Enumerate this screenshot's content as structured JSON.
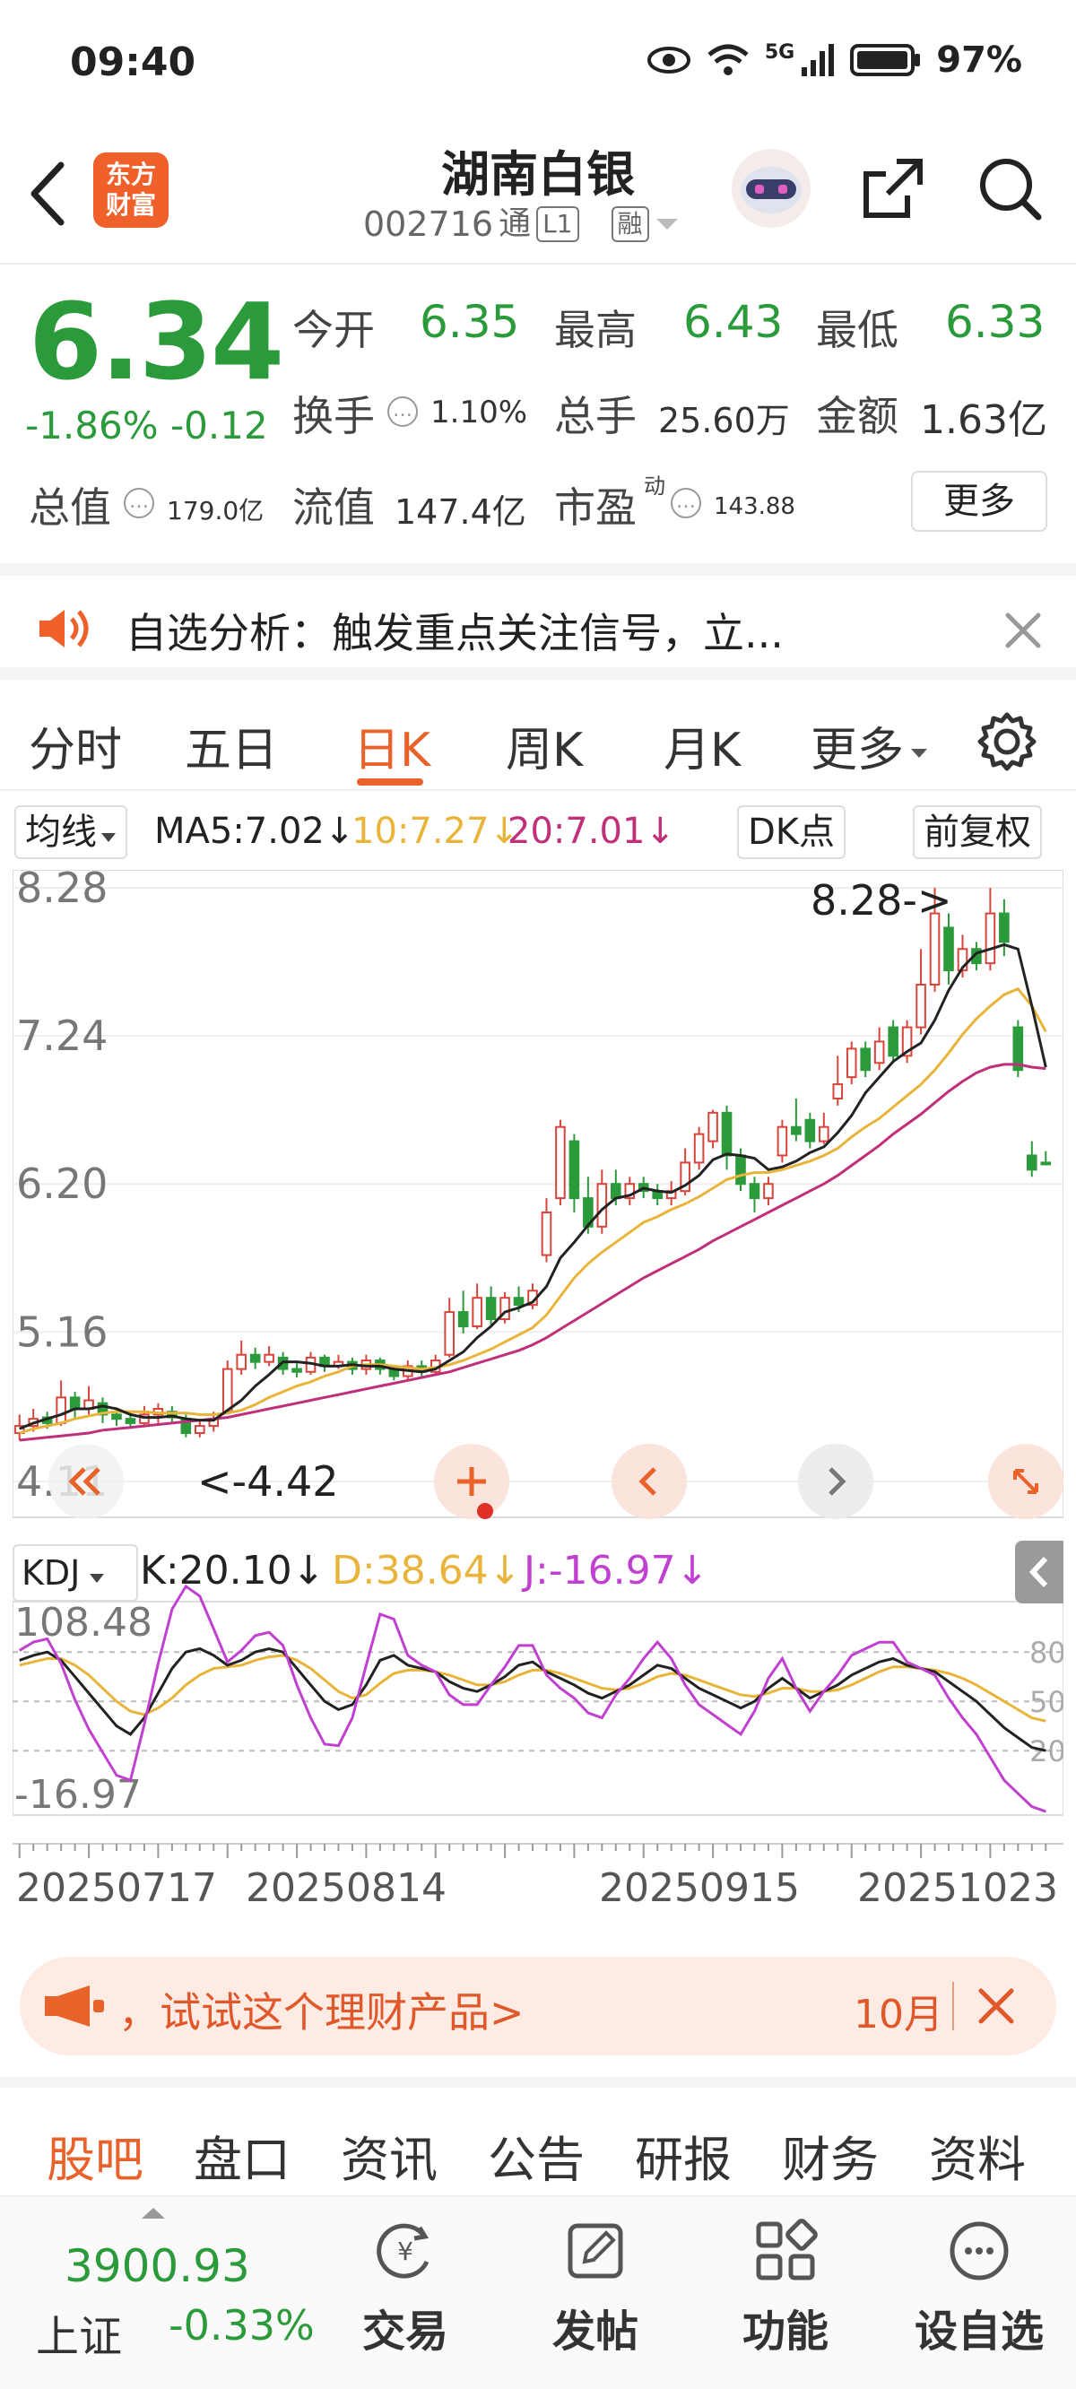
{
  "status_bar": {
    "time": "09:40",
    "battery": "97%",
    "network": "5G"
  },
  "header": {
    "logo_text_1": "东方",
    "logo_text_2": "财富",
    "stock_name": "湖南白银",
    "stock_code": "002716",
    "tags": [
      "通",
      "L1",
      "融"
    ]
  },
  "quote": {
    "price": "6.34",
    "change_pct": "-1.86%",
    "change_abs": "-0.12",
    "open_label": "今开",
    "open": "6.35",
    "high_label": "最高",
    "high": "6.43",
    "low_label": "最低",
    "low": "6.33",
    "turnover_label": "换手",
    "turnover": "1.10%",
    "volume_label": "总手",
    "volume": "25.60万",
    "amount_label": "金额",
    "amount": "1.63亿",
    "mktcap_label": "总值",
    "mktcap": "179.0亿",
    "float_label": "流值",
    "float": "147.4亿",
    "pe_label": "市盈",
    "pe_sup": "动",
    "pe": "143.88",
    "more_label": "更多"
  },
  "notice": {
    "text": "自选分析：触发重点关注信号，立..."
  },
  "tabs": [
    "分时",
    "五日",
    "日K",
    "周K",
    "月K",
    "更多"
  ],
  "active_tab": "日K",
  "ma_bar": {
    "selector": "均线",
    "ma5": "MA5:7.02↓",
    "ma10": "10:7.27↓",
    "ma20": "20:7.01↓",
    "dk": "DK点",
    "adjust": "前复权"
  },
  "chart_data": {
    "type": "candlestick",
    "y_ticks": [
      "8.28",
      "7.24",
      "6.20",
      "5.16",
      "4.11"
    ],
    "ylim": [
      4.11,
      8.28
    ],
    "max_label": "8.28->",
    "min_label": "<-4.42",
    "x_labels": [
      "20250717",
      "20250814",
      "20250915",
      "20251023"
    ],
    "candles": [
      {
        "o": 4.45,
        "c": 4.5,
        "h": 4.58,
        "l": 4.4
      },
      {
        "o": 4.5,
        "c": 4.55,
        "h": 4.62,
        "l": 4.46
      },
      {
        "o": 4.56,
        "c": 4.52,
        "h": 4.6,
        "l": 4.48
      },
      {
        "o": 4.52,
        "c": 4.7,
        "h": 4.82,
        "l": 4.5
      },
      {
        "o": 4.7,
        "c": 4.62,
        "h": 4.74,
        "l": 4.55
      },
      {
        "o": 4.62,
        "c": 4.68,
        "h": 4.78,
        "l": 4.58
      },
      {
        "o": 4.66,
        "c": 4.58,
        "h": 4.7,
        "l": 4.52
      },
      {
        "o": 4.58,
        "c": 4.55,
        "h": 4.63,
        "l": 4.5
      },
      {
        "o": 4.55,
        "c": 4.52,
        "h": 4.6,
        "l": 4.48
      },
      {
        "o": 4.52,
        "c": 4.58,
        "h": 4.64,
        "l": 4.49
      },
      {
        "o": 4.58,
        "c": 4.62,
        "h": 4.66,
        "l": 4.52
      },
      {
        "o": 4.6,
        "c": 4.56,
        "h": 4.64,
        "l": 4.52
      },
      {
        "o": 4.55,
        "c": 4.45,
        "h": 4.58,
        "l": 4.42
      },
      {
        "o": 4.45,
        "c": 4.5,
        "h": 4.55,
        "l": 4.42
      },
      {
        "o": 4.5,
        "c": 4.55,
        "h": 4.6,
        "l": 4.46
      },
      {
        "o": 4.6,
        "c": 4.9,
        "h": 4.96,
        "l": 4.58
      },
      {
        "o": 4.9,
        "c": 5.0,
        "h": 5.1,
        "l": 4.86
      },
      {
        "o": 5.0,
        "c": 4.95,
        "h": 5.05,
        "l": 4.9
      },
      {
        "o": 4.95,
        "c": 5.0,
        "h": 5.06,
        "l": 4.92
      },
      {
        "o": 4.98,
        "c": 4.9,
        "h": 5.02,
        "l": 4.86
      },
      {
        "o": 4.9,
        "c": 4.88,
        "h": 4.94,
        "l": 4.84
      },
      {
        "o": 4.88,
        "c": 4.98,
        "h": 5.02,
        "l": 4.86
      },
      {
        "o": 4.98,
        "c": 4.92,
        "h": 5.0,
        "l": 4.88
      },
      {
        "o": 4.92,
        "c": 4.95,
        "h": 5.0,
        "l": 4.9
      },
      {
        "o": 4.95,
        "c": 4.9,
        "h": 4.98,
        "l": 4.86
      },
      {
        "o": 4.9,
        "c": 4.96,
        "h": 5.0,
        "l": 4.86
      },
      {
        "o": 4.96,
        "c": 4.9,
        "h": 4.98,
        "l": 4.86
      },
      {
        "o": 4.9,
        "c": 4.85,
        "h": 4.92,
        "l": 4.82
      },
      {
        "o": 4.85,
        "c": 4.92,
        "h": 4.96,
        "l": 4.82
      },
      {
        "o": 4.92,
        "c": 4.88,
        "h": 4.96,
        "l": 4.84
      },
      {
        "o": 4.88,
        "c": 4.96,
        "h": 5.0,
        "l": 4.85
      },
      {
        "o": 5.0,
        "c": 5.3,
        "h": 5.4,
        "l": 4.98
      },
      {
        "o": 5.3,
        "c": 5.2,
        "h": 5.45,
        "l": 5.15
      },
      {
        "o": 5.2,
        "c": 5.4,
        "h": 5.5,
        "l": 5.18
      },
      {
        "o": 5.4,
        "c": 5.25,
        "h": 5.48,
        "l": 5.2
      },
      {
        "o": 5.25,
        "c": 5.4,
        "h": 5.44,
        "l": 5.22
      },
      {
        "o": 5.4,
        "c": 5.35,
        "h": 5.48,
        "l": 5.3
      },
      {
        "o": 5.35,
        "c": 5.45,
        "h": 5.5,
        "l": 5.32
      },
      {
        "o": 5.7,
        "c": 6.0,
        "h": 6.1,
        "l": 5.65
      },
      {
        "o": 6.1,
        "c": 6.6,
        "h": 6.65,
        "l": 6.05
      },
      {
        "o": 6.5,
        "c": 6.1,
        "h": 6.55,
        "l": 6.0
      },
      {
        "o": 6.1,
        "c": 5.9,
        "h": 6.25,
        "l": 5.85
      },
      {
        "o": 5.9,
        "c": 6.2,
        "h": 6.3,
        "l": 5.85
      },
      {
        "o": 6.2,
        "c": 6.1,
        "h": 6.3,
        "l": 6.05
      },
      {
        "o": 6.1,
        "c": 6.2,
        "h": 6.25,
        "l": 6.05
      },
      {
        "o": 6.2,
        "c": 6.15,
        "h": 6.25,
        "l": 6.1
      },
      {
        "o": 6.15,
        "c": 6.1,
        "h": 6.2,
        "l": 6.05
      },
      {
        "o": 6.1,
        "c": 6.15,
        "h": 6.22,
        "l": 6.05
      },
      {
        "o": 6.15,
        "c": 6.35,
        "h": 6.45,
        "l": 6.12
      },
      {
        "o": 6.35,
        "c": 6.55,
        "h": 6.6,
        "l": 6.3
      },
      {
        "o": 6.5,
        "c": 6.7,
        "h": 6.72,
        "l": 6.45
      },
      {
        "o": 6.7,
        "c": 6.4,
        "h": 6.75,
        "l": 6.3
      },
      {
        "o": 6.4,
        "c": 6.2,
        "h": 6.45,
        "l": 6.15
      },
      {
        "o": 6.2,
        "c": 6.1,
        "h": 6.25,
        "l": 6.0
      },
      {
        "o": 6.1,
        "c": 6.2,
        "h": 6.25,
        "l": 6.05
      },
      {
        "o": 6.4,
        "c": 6.6,
        "h": 6.65,
        "l": 6.35
      },
      {
        "o": 6.6,
        "c": 6.55,
        "h": 6.8,
        "l": 6.5
      },
      {
        "o": 6.65,
        "c": 6.5,
        "h": 6.7,
        "l": 6.45
      },
      {
        "o": 6.5,
        "c": 6.6,
        "h": 6.7,
        "l": 6.48
      },
      {
        "o": 6.8,
        "c": 6.9,
        "h": 7.1,
        "l": 6.75
      },
      {
        "o": 6.95,
        "c": 7.15,
        "h": 7.2,
        "l": 6.9
      },
      {
        "o": 7.15,
        "c": 7.0,
        "h": 7.2,
        "l": 6.95
      },
      {
        "o": 7.05,
        "c": 7.2,
        "h": 7.3,
        "l": 7.0
      },
      {
        "o": 7.3,
        "c": 7.1,
        "h": 7.35,
        "l": 7.05
      },
      {
        "o": 7.1,
        "c": 7.3,
        "h": 7.35,
        "l": 7.05
      },
      {
        "o": 7.3,
        "c": 7.6,
        "h": 7.85,
        "l": 7.25
      },
      {
        "o": 7.6,
        "c": 8.1,
        "h": 8.28,
        "l": 7.55
      },
      {
        "o": 8.0,
        "c": 7.7,
        "h": 8.1,
        "l": 7.6
      },
      {
        "o": 7.7,
        "c": 7.85,
        "h": 7.95,
        "l": 7.65
      },
      {
        "o": 7.85,
        "c": 7.75,
        "h": 7.9,
        "l": 7.7
      },
      {
        "o": 7.75,
        "c": 8.1,
        "h": 8.28,
        "l": 7.7
      },
      {
        "o": 8.1,
        "c": 7.9,
        "h": 8.2,
        "l": 7.8
      },
      {
        "o": 7.3,
        "c": 7.0,
        "h": 7.35,
        "l": 6.95
      },
      {
        "o": 6.4,
        "c": 6.3,
        "h": 6.5,
        "l": 6.25
      },
      {
        "o": 6.35,
        "c": 6.34,
        "h": 6.43,
        "l": 6.33
      }
    ],
    "ma5": [
      4.48,
      4.52,
      4.55,
      4.58,
      4.62,
      4.62,
      4.64,
      4.62,
      4.58,
      4.56,
      4.56,
      4.57,
      4.55,
      4.54,
      4.54,
      4.61,
      4.68,
      4.78,
      4.86,
      4.95,
      4.95,
      4.94,
      4.92,
      4.92,
      4.93,
      4.92,
      4.92,
      4.9,
      4.89,
      4.88,
      4.9,
      4.96,
      5.02,
      5.12,
      5.2,
      5.3,
      5.33,
      5.37,
      5.48,
      5.68,
      5.79,
      5.91,
      6.02,
      6.1,
      6.12,
      6.17,
      6.15,
      6.14,
      6.19,
      6.26,
      6.37,
      6.41,
      6.4,
      6.38,
      6.3,
      6.32,
      6.36,
      6.42,
      6.46,
      6.56,
      6.68,
      6.84,
      6.95,
      7.06,
      7.13,
      7.19,
      7.35,
      7.56,
      7.72,
      7.82,
      7.85,
      7.88,
      7.85,
      7.45,
      7.02
    ],
    "ma10": [
      4.45,
      4.48,
      4.5,
      4.52,
      4.55,
      4.57,
      4.59,
      4.6,
      4.6,
      4.6,
      4.59,
      4.59,
      4.59,
      4.58,
      4.58,
      4.59,
      4.61,
      4.65,
      4.7,
      4.74,
      4.78,
      4.81,
      4.85,
      4.88,
      4.92,
      4.93,
      4.93,
      4.92,
      4.91,
      4.9,
      4.91,
      4.93,
      4.96,
      5.0,
      5.04,
      5.09,
      5.14,
      5.19,
      5.28,
      5.41,
      5.54,
      5.64,
      5.72,
      5.79,
      5.86,
      5.93,
      5.97,
      6.02,
      6.06,
      6.11,
      6.17,
      6.23,
      6.26,
      6.28,
      6.28,
      6.3,
      6.33,
      6.36,
      6.4,
      6.45,
      6.53,
      6.6,
      6.66,
      6.74,
      6.82,
      6.9,
      7.0,
      7.12,
      7.25,
      7.36,
      7.45,
      7.53,
      7.57,
      7.45,
      7.27
    ],
    "ma20": [
      4.4,
      4.41,
      4.42,
      4.43,
      4.44,
      4.45,
      4.47,
      4.48,
      4.49,
      4.5,
      4.51,
      4.52,
      4.53,
      4.54,
      4.55,
      4.56,
      4.58,
      4.6,
      4.62,
      4.64,
      4.66,
      4.68,
      4.7,
      4.72,
      4.74,
      4.76,
      4.78,
      4.8,
      4.82,
      4.84,
      4.86,
      4.88,
      4.91,
      4.94,
      4.97,
      5.0,
      5.03,
      5.07,
      5.12,
      5.18,
      5.24,
      5.3,
      5.36,
      5.42,
      5.48,
      5.54,
      5.59,
      5.64,
      5.69,
      5.74,
      5.8,
      5.85,
      5.9,
      5.95,
      6.0,
      6.05,
      6.1,
      6.15,
      6.2,
      6.26,
      6.33,
      6.4,
      6.47,
      6.55,
      6.62,
      6.69,
      6.77,
      6.85,
      6.92,
      6.98,
      7.02,
      7.04,
      7.04,
      7.02,
      7.01
    ],
    "kdj": {
      "label": "KDJ",
      "k_text": "K:20.10↓",
      "d_text": "D:38.64↓",
      "j_text": "J:-16.97↓",
      "ylim": [
        -16.97,
        108.48
      ],
      "y_top": "108.48",
      "y_bottom": "-16.97",
      "ref_levels": [
        "80",
        "50",
        "20"
      ],
      "k": [
        75,
        78,
        80,
        75,
        65,
        55,
        45,
        35,
        30,
        40,
        55,
        70,
        80,
        82,
        78,
        72,
        75,
        80,
        82,
        80,
        70,
        60,
        50,
        45,
        48,
        60,
        75,
        78,
        72,
        70,
        68,
        62,
        58,
        56,
        60,
        65,
        72,
        74,
        68,
        64,
        60,
        55,
        52,
        56,
        60,
        66,
        72,
        70,
        64,
        58,
        54,
        50,
        46,
        50,
        58,
        64,
        58,
        52,
        56,
        60,
        66,
        70,
        74,
        76,
        72,
        70,
        68,
        62,
        56,
        50,
        42,
        34,
        28,
        22,
        20
      ],
      "d": [
        72,
        74,
        76,
        76,
        72,
        66,
        58,
        50,
        44,
        42,
        46,
        52,
        60,
        66,
        70,
        71,
        72,
        75,
        77,
        78,
        75,
        70,
        63,
        56,
        52,
        54,
        61,
        67,
        69,
        69,
        68,
        66,
        63,
        60,
        60,
        62,
        66,
        69,
        69,
        67,
        64,
        61,
        58,
        57,
        58,
        61,
        65,
        67,
        66,
        63,
        60,
        57,
        54,
        53,
        55,
        58,
        58,
        56,
        56,
        57,
        60,
        64,
        68,
        71,
        71,
        70,
        69,
        67,
        64,
        60,
        55,
        50,
        45,
        40,
        38
      ],
      "j": [
        81,
        86,
        88,
        73,
        51,
        33,
        19,
        5,
        2,
        36,
        73,
        106,
        120,
        114,
        94,
        74,
        81,
        90,
        92,
        84,
        60,
        40,
        24,
        23,
        40,
        72,
        103,
        100,
        78,
        72,
        68,
        54,
        48,
        48,
        60,
        71,
        84,
        84,
        66,
        58,
        52,
        43,
        40,
        54,
        64,
        76,
        86,
        76,
        60,
        48,
        42,
        36,
        30,
        44,
        64,
        76,
        58,
        44,
        56,
        66,
        78,
        82,
        86,
        86,
        74,
        70,
        66,
        52,
        40,
        30,
        16,
        2,
        -6,
        -14,
        -17
      ]
    }
  },
  "promo": {
    "text": "，试试这个理财产品>",
    "date": "10月"
  },
  "sub_tabs": [
    "股吧",
    "盘口",
    "资讯",
    "公告",
    "研报",
    "财务",
    "资料"
  ],
  "active_sub_tab": "股吧",
  "bottom_nav": {
    "index_value": "3900.93",
    "index_name": "上证",
    "index_change": "-0.33%",
    "items": [
      "交易",
      "发帖",
      "功能",
      "设自选"
    ]
  },
  "colors": {
    "accent": "#e8622a",
    "down": "#2a9a3a",
    "up": "#d9443a",
    "ma5": "#222222",
    "ma10": "#e8b43a",
    "ma20": "#c0307a"
  }
}
